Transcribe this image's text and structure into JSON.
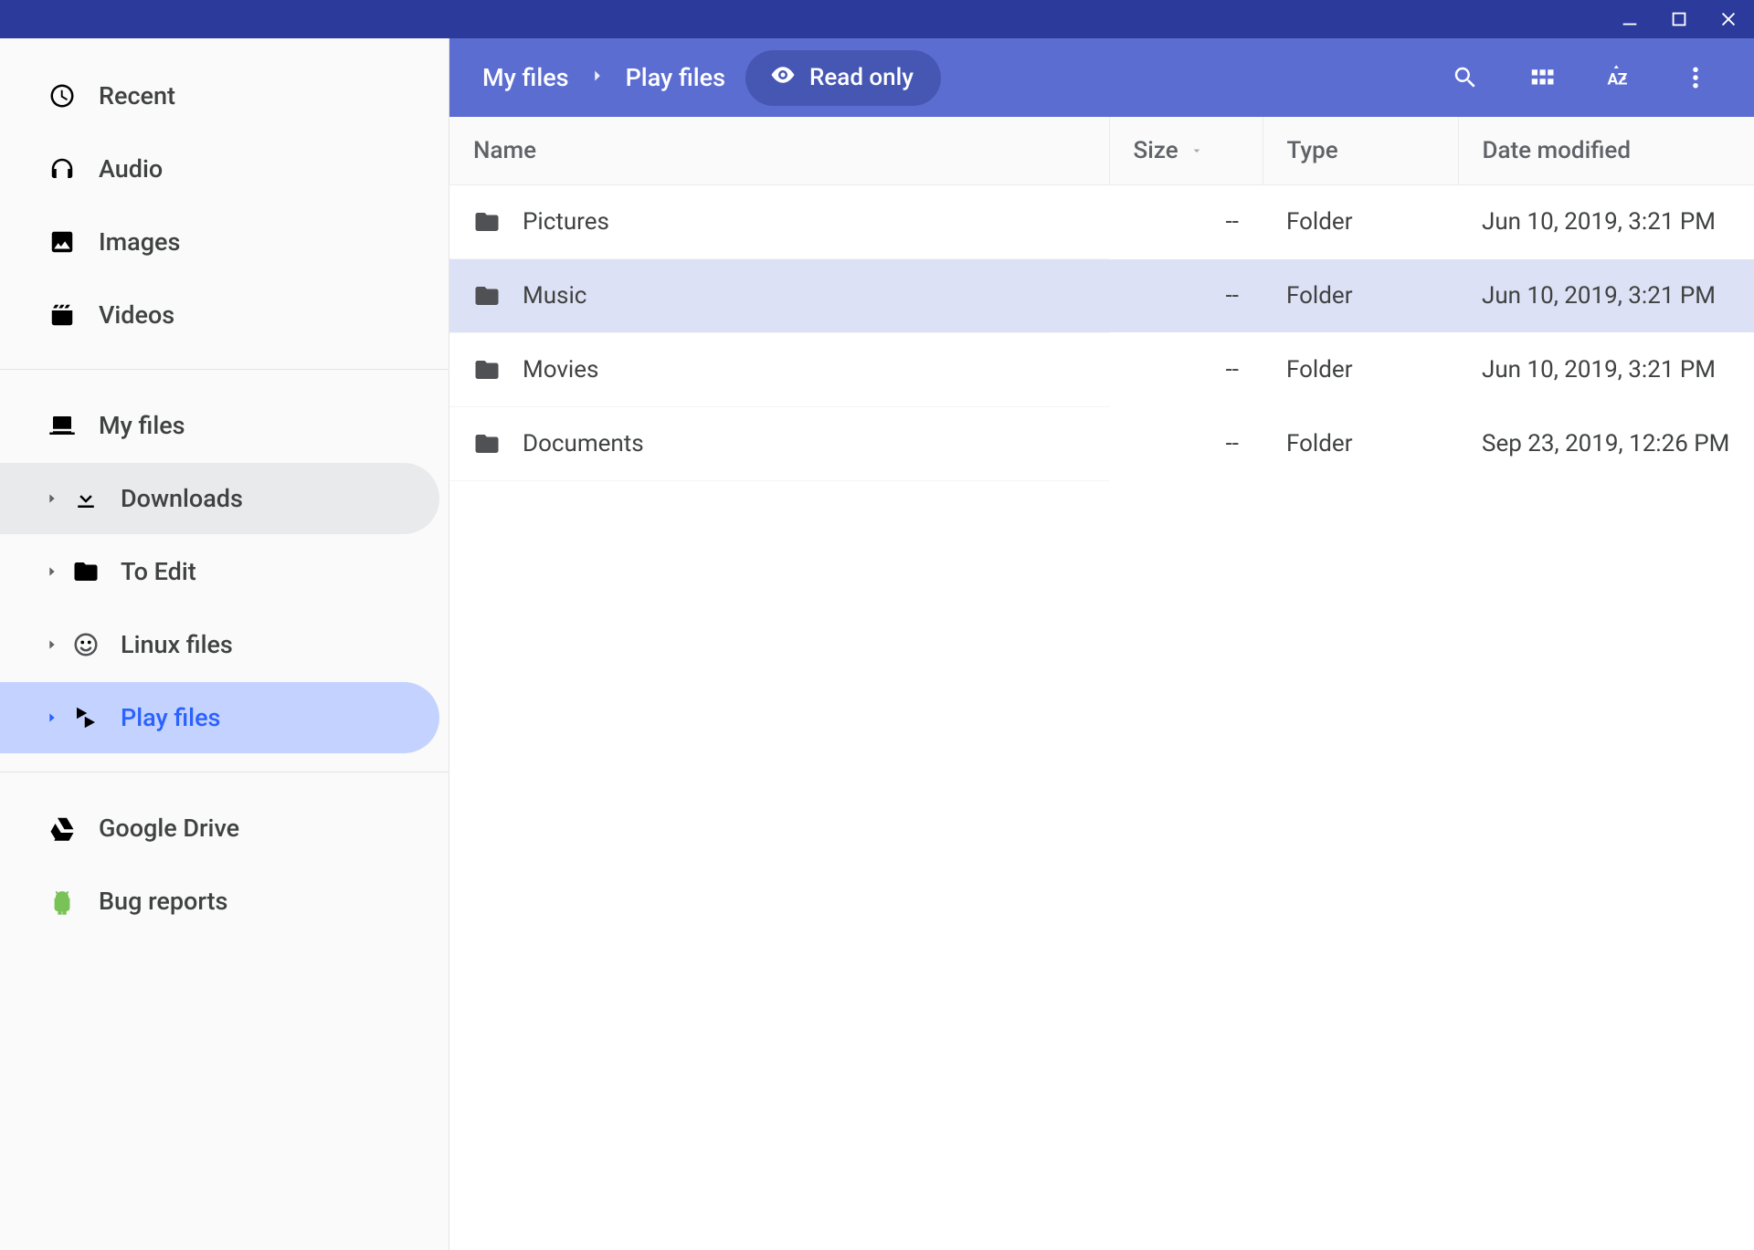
{
  "window": {
    "minimize": "Minimize",
    "maximize": "Maximize",
    "close": "Close"
  },
  "sidebar": {
    "groups": [
      {
        "items": [
          {
            "id": "recent",
            "label": "Recent",
            "icon": "clock",
            "indent": 0,
            "expander": null,
            "chip": null
          },
          {
            "id": "audio",
            "label": "Audio",
            "icon": "headphones",
            "indent": 0,
            "expander": null,
            "chip": null
          },
          {
            "id": "images",
            "label": "Images",
            "icon": "image",
            "indent": 0,
            "expander": null,
            "chip": null
          },
          {
            "id": "videos",
            "label": "Videos",
            "icon": "clapper",
            "indent": 0,
            "expander": null,
            "chip": null
          }
        ]
      },
      {
        "items": [
          {
            "id": "myfiles",
            "label": "My files",
            "icon": "laptop",
            "indent": 0,
            "expander": "down",
            "chip": null
          },
          {
            "id": "downloads",
            "label": "Downloads",
            "icon": "download",
            "indent": 1,
            "expander": "right",
            "chip": "grey"
          },
          {
            "id": "toedit",
            "label": "To Edit",
            "icon": "folder",
            "indent": 1,
            "expander": "right",
            "chip": null
          },
          {
            "id": "linux",
            "label": "Linux files",
            "icon": "linux",
            "indent": 1,
            "expander": "right",
            "chip": null
          },
          {
            "id": "playfiles",
            "label": "Play files",
            "icon": "play",
            "indent": 1,
            "expander": "right",
            "chip": "blue"
          }
        ]
      },
      {
        "items": [
          {
            "id": "gdrive",
            "label": "Google Drive",
            "icon": "drive",
            "indent": 0,
            "expander": "right",
            "chip": null
          },
          {
            "id": "bugs",
            "label": "Bug reports",
            "icon": "android",
            "indent": 0,
            "expander": null,
            "chip": null
          }
        ]
      }
    ]
  },
  "header": {
    "breadcrumbs": [
      "My files",
      "Play files"
    ],
    "readonly_label": "Read only",
    "actions": {
      "search": "Search",
      "view": "View as grid",
      "sort": "Sort options",
      "menu": "More options"
    }
  },
  "columns": {
    "name": "Name",
    "size": "Size",
    "type": "Type",
    "date": "Date modified"
  },
  "rows": [
    {
      "name": "Pictures",
      "size": "--",
      "type": "Folder",
      "date": "Jun 10, 2019, 3:21 PM",
      "selected": false
    },
    {
      "name": "Music",
      "size": "--",
      "type": "Folder",
      "date": "Jun 10, 2019, 3:21 PM",
      "selected": true
    },
    {
      "name": "Movies",
      "size": "--",
      "type": "Folder",
      "date": "Jun 10, 2019, 3:21 PM",
      "selected": false
    },
    {
      "name": "Documents",
      "size": "--",
      "type": "Folder",
      "date": "Sep 23, 2019, 12:26 PM",
      "selected": false
    }
  ]
}
